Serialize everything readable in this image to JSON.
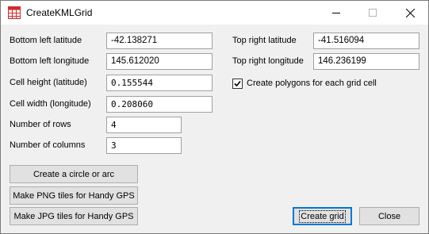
{
  "window": {
    "title": "CreateKMLGrid"
  },
  "form": {
    "bottom_left_latitude": {
      "label": "Bottom left latitude",
      "value": "-42.138271"
    },
    "bottom_left_longitude": {
      "label": "Bottom left longitude",
      "value": "145.612020"
    },
    "cell_height": {
      "label": "Cell height (latitude)",
      "value": "0.155544"
    },
    "cell_width": {
      "label": "Cell width (longitude)",
      "value": "0.208060"
    },
    "number_of_rows": {
      "label": "Number of rows",
      "value": "4"
    },
    "number_of_columns": {
      "label": "Number of columns",
      "value": "3"
    },
    "top_right_latitude": {
      "label": "Top right latitude",
      "value": "-41.516094"
    },
    "top_right_longitude": {
      "label": "Top right longitude",
      "value": "146.236199"
    },
    "polygons_checkbox": {
      "label": "Create polygons for each grid cell",
      "checked": true
    }
  },
  "buttons": {
    "circle": "Create a circle or arc",
    "png": "Make PNG tiles for Handy GPS",
    "jpg": "Make JPG tiles for Handy GPS",
    "create": "Create grid",
    "close": "Close"
  },
  "icons": {
    "app": "grid-app-icon",
    "minimize": "minimize-icon",
    "maximize": "maximize-icon",
    "close": "close-icon",
    "check": "checkmark-icon"
  },
  "colors": {
    "app_icon": "#d42a2a",
    "focus_border": "#0078d7"
  }
}
